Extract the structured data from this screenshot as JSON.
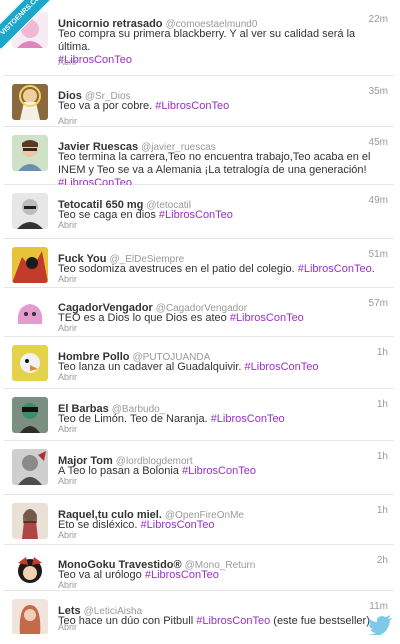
{
  "watermark": "VISTOENRS.COM",
  "open_label": "Abrir",
  "tweets": [
    {
      "name": "Unicornio retrasado",
      "handle": "@comoestaelmund0",
      "time": "22m",
      "text": "Teo compra su primera blackberry. Y al ver su calidad será la última.",
      "hashtag": "#LibrosConTeo",
      "after": ""
    },
    {
      "name": "Dios",
      "handle": "@Sr_Dios",
      "time": "35m",
      "text": "Teo va a por cobre.",
      "hashtag": "#LibrosConTeo",
      "after": ""
    },
    {
      "name": "Javier Ruescas",
      "handle": "@javier_ruescas",
      "time": "45m",
      "text": "Teo termina la carrera,Teo no encuentra trabajo,Teo acaba en el INEM y Teo se va a Alemania ¡La tetralogía de una generación!",
      "hashtag": "#LibrosConTeo",
      "after": ""
    },
    {
      "name": "Tetocatil 650 mg",
      "handle": "@tetocatil",
      "time": "49m",
      "text": "Teo se caga en dios",
      "hashtag": "#LibrosConTeo",
      "after": ""
    },
    {
      "name": "Fuck You",
      "handle": "@_ElDeSiempre",
      "time": "51m",
      "text": "Teo sodomiza avestruces en el patio del colegio.",
      "hashtag": "#LibrosConTeo",
      "after": "."
    },
    {
      "name": "CagadorVengador",
      "handle": "@CagadorVengador",
      "time": "57m",
      "text": "TEO es a Dios lo que Dios es ateo",
      "hashtag": "#LibrosConTeo",
      "after": ""
    },
    {
      "name": "Hombre Pollo",
      "handle": "@PUTOJUANDA",
      "time": "1h",
      "text": "Teo lanza un cadaver al Guadalquivir.",
      "hashtag": "#LibrosConTeo",
      "after": ""
    },
    {
      "name": "El Barbas",
      "handle": "@Barbudo_",
      "time": "1h",
      "text": "Teo de Limón. Teo de Naranja.",
      "hashtag": "#LibrosConTeo",
      "after": ""
    },
    {
      "name": "Major Tom",
      "handle": "@lordblogdemort",
      "time": "1h",
      "text": "A Teo lo pasan a Bolonia",
      "hashtag": "#LibrosConTeo",
      "after": ""
    },
    {
      "name": "Raquel,tu culo miel.",
      "handle": "@OpenFireOnMe",
      "time": "1h",
      "text": "Eto se disléxico.",
      "hashtag": "#LibrosConTeo",
      "after": ""
    },
    {
      "name": "MonoGoku Travestido®",
      "handle": "@Mono_Return",
      "time": "2h",
      "text": "Teo va al urólogo",
      "hashtag": "#LibrosConTeo",
      "after": ""
    },
    {
      "name": "Lets",
      "handle": "@LeticiAisha",
      "time": "11m",
      "text": "Teo hace un dúo con Pitbull",
      "hashtag": "#LibrosConTeo",
      "after": " (este fue bestseller)."
    }
  ],
  "avatar_colors": [
    "#f0d7e8",
    "#c98a5a",
    "#7fa37a",
    "#3a3a3a",
    "#c23b2b",
    "#e7a9d6",
    "#d8c23a",
    "#3f8f6a",
    "#6b6b6b",
    "#b04545",
    "#5a3b7a",
    "#c26a4a"
  ]
}
